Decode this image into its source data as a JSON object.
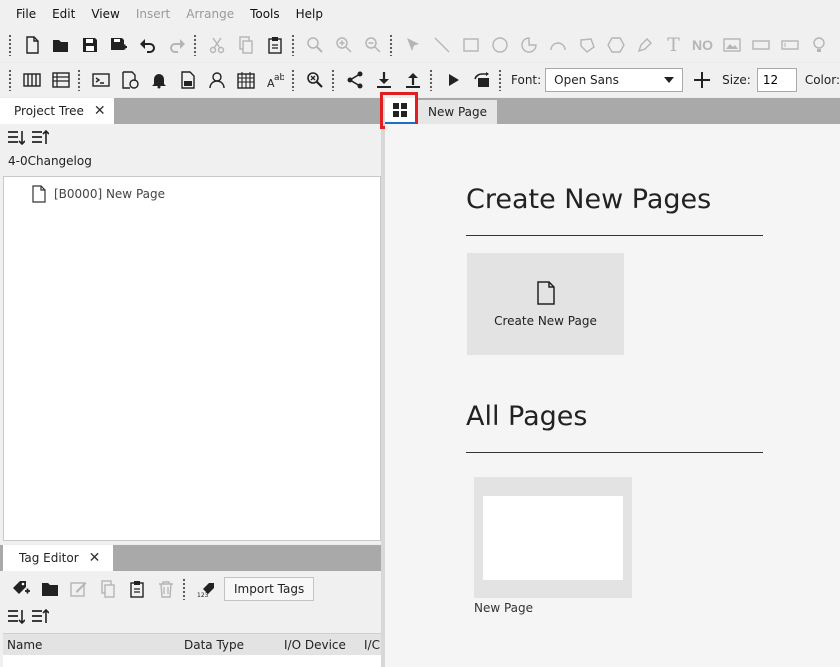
{
  "menu": [
    {
      "label": "File",
      "enabled": true
    },
    {
      "label": "Edit",
      "enabled": true
    },
    {
      "label": "View",
      "enabled": true
    },
    {
      "label": "Insert",
      "enabled": false
    },
    {
      "label": "Arrange",
      "enabled": false
    },
    {
      "label": "Tools",
      "enabled": true
    },
    {
      "label": "Help",
      "enabled": true
    }
  ],
  "toolbar": {
    "text_tool_glyph": "T",
    "no_tool_glyph": "NO",
    "font_label": "Font:",
    "font_value": "Open Sans",
    "size_label": "Size:",
    "size_value": "12",
    "color_label": "Color:"
  },
  "project_tree": {
    "tab_label": "Project Tree",
    "project_name": "4-0Changelog",
    "items": [
      {
        "label": "[B0000] New Page"
      }
    ]
  },
  "tag_editor": {
    "tab_label": "Tag Editor",
    "import_label": "Import Tags",
    "columns": [
      "Name",
      "Data Type",
      "I/O Device",
      "I/C"
    ]
  },
  "document": {
    "tab_label": "New Page",
    "create_heading": "Create New Pages",
    "create_card_label": "Create New Page",
    "all_heading": "All Pages",
    "pages": [
      {
        "label": "New Page"
      }
    ]
  },
  "colors": {
    "highlight": "#e02020",
    "active_tab_underline": "#1a6fc9"
  }
}
